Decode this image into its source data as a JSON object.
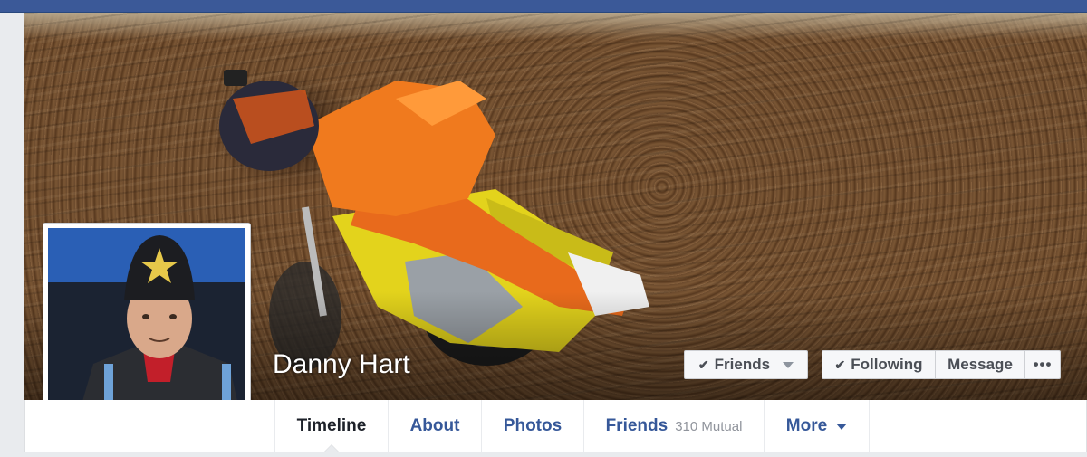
{
  "profile": {
    "name": "Danny Hart"
  },
  "actions": {
    "friends_label": "Friends",
    "following_label": "Following",
    "message_label": "Message",
    "more_label": "•••"
  },
  "nav": {
    "tabs": [
      {
        "label": "Timeline",
        "active": true
      },
      {
        "label": "About"
      },
      {
        "label": "Photos"
      },
      {
        "label": "Friends",
        "count": "310 Mutual"
      },
      {
        "label": "More"
      }
    ]
  },
  "colors": {
    "brand_blue": "#3b5998",
    "link_blue": "#365899",
    "active_text": "#1d2129"
  },
  "icons": {
    "checkmark": "check-icon",
    "dropdown": "caret-down-icon",
    "overflow": "more-dots-icon"
  }
}
